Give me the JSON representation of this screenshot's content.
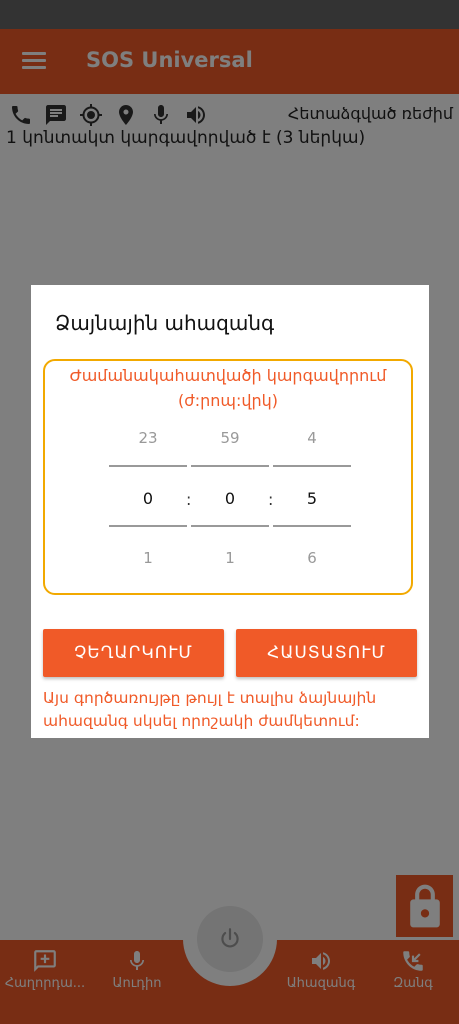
{
  "app": {
    "title": "SOS Universal"
  },
  "status": {
    "mode_text": "Հետաձգված ռեժիմ",
    "contacts_text": "1 կոնտակտ կարգավորված է (3 ներկա)"
  },
  "toolbar_icons": [
    "phone-icon",
    "message-icon",
    "gps-icon",
    "location-pin-icon",
    "microphone-icon",
    "volume-icon"
  ],
  "dialog": {
    "title": "Ձայնային ահազանգ",
    "time_label": "Ժամանակահատվածի կարգավորում (ժ:րոպ:վրկ)",
    "picker": {
      "hours": {
        "prev": "23",
        "value": "0",
        "next": "1"
      },
      "minutes": {
        "prev": "59",
        "value": "0",
        "next": "1"
      },
      "seconds": {
        "prev": "4",
        "value": "5",
        "next": "6"
      },
      "separator": ":"
    },
    "cancel_label": "ՉԵՂԱՐԿՈՒՄ",
    "confirm_label": "ՀԱՍՏԱՏՈՒՄ",
    "note": "Այս գործառույթը թույլ է տալիս ձայնային ահազանգ սկսել որոշակի ժամկետում:"
  },
  "bottom_nav": {
    "items": [
      {
        "label": "Հաղորդա...",
        "icon": "add-message-icon"
      },
      {
        "label": "Աուդիո",
        "icon": "microphone-icon"
      },
      {
        "label": "Ահազանգ",
        "icon": "volume-icon"
      },
      {
        "label": "Զանգ",
        "icon": "phone-callback-icon"
      }
    ]
  },
  "colors": {
    "accent": "#f05a28",
    "timebox_border": "#f2a900"
  }
}
